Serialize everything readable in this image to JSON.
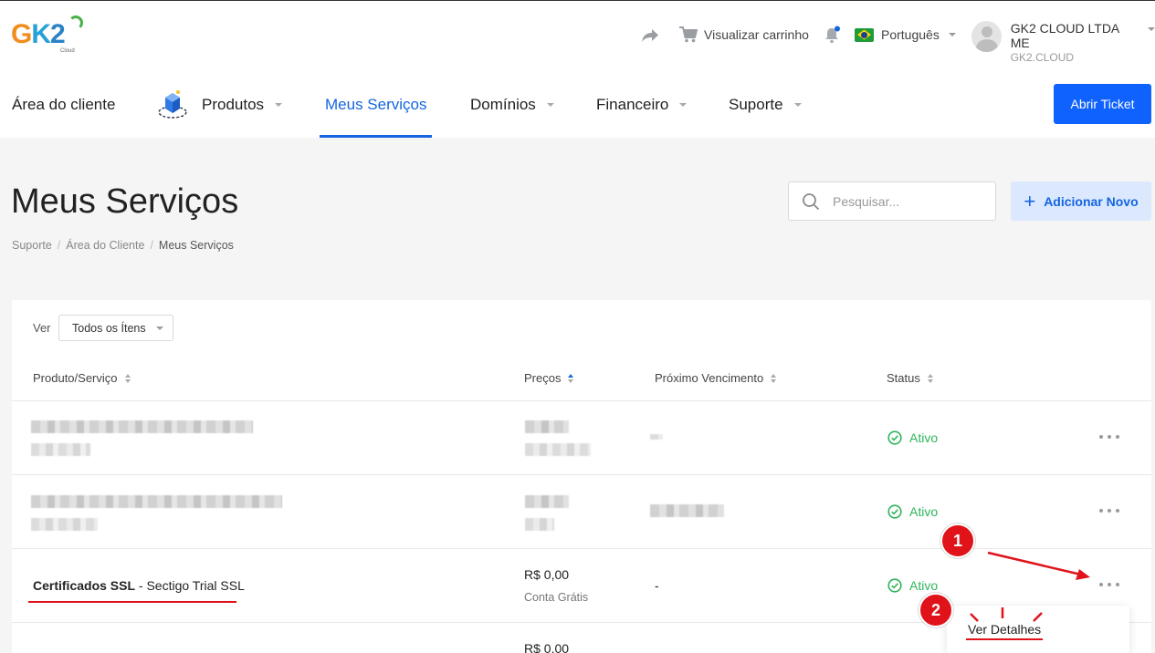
{
  "header": {
    "logo": {
      "text_g": "G",
      "text_k": "K",
      "text_2": "2",
      "sub": "Cloud"
    },
    "cart_label": "Visualizar carrinho",
    "language": "Português",
    "account_name": "GK2 CLOUD LTDA ME",
    "account_domain": "GK2.CLOUD",
    "icons": [
      "share-icon",
      "cart-icon",
      "bell-icon",
      "brazil-flag-icon",
      "avatar-icon"
    ],
    "colors": {
      "brand_blue": "#0f62fe",
      "logo_orange": "#f28c1e",
      "logo_blue": "#27a1d8",
      "logo_green": "#49b04b"
    }
  },
  "nav": {
    "items": [
      {
        "label": "Área do cliente"
      },
      {
        "label": "Produtos"
      },
      {
        "label": "Meus Serviços"
      },
      {
        "label": "Domínios"
      },
      {
        "label": "Financeiro"
      },
      {
        "label": "Suporte"
      }
    ],
    "active": "Meus Serviços",
    "ticket_button": "Abrir Ticket"
  },
  "page": {
    "title": "Meus Serviços",
    "breadcrumb": [
      "Suporte",
      "Área do Cliente",
      "Meus Serviços"
    ],
    "search_placeholder": "Pesquisar...",
    "add_button": "Adicionar Novo"
  },
  "table": {
    "view_label": "Ver",
    "view_value": "Todos os Ítens",
    "columns": [
      "Produto/Serviço",
      "Preços",
      "Próximo Vencimento",
      "Status"
    ],
    "sorted_column": "Preços",
    "rows": [
      {
        "product": "",
        "product_sub": "",
        "price": "",
        "price_sub": "",
        "due": "",
        "status": "Ativo",
        "redacted": true
      },
      {
        "product": "",
        "product_sub": "",
        "price": "",
        "price_sub": "",
        "due": "",
        "status": "Ativo",
        "redacted": true
      },
      {
        "product_bold": "Certificados SSL",
        "product_rest": " - Sectigo Trial SSL",
        "price": "R$ 0,00",
        "price_sub": "Conta Grátis",
        "due": "-",
        "status": "Ativo",
        "redacted": false
      },
      {
        "price": "R$ 0,00"
      }
    ],
    "status_color": "#2eb45a"
  },
  "dropdown": {
    "item": "Ver Detalhes"
  },
  "annotations": {
    "step1": "1",
    "step2": "2",
    "color": "#e0131a"
  }
}
